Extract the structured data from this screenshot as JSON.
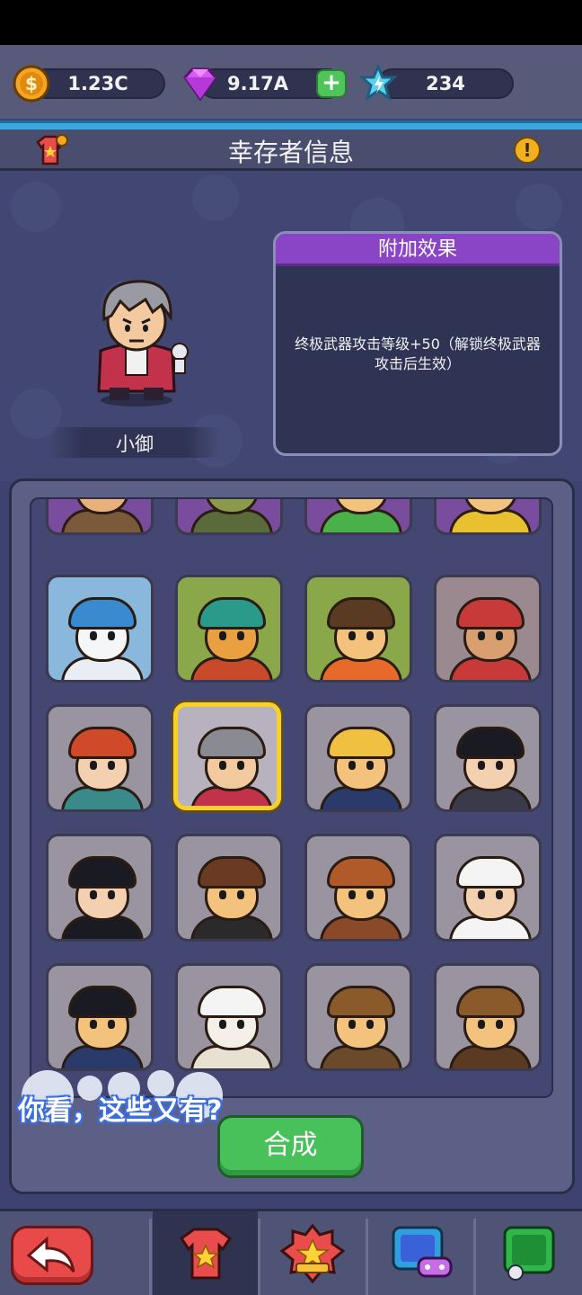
{
  "currency": {
    "gold": "1.23C",
    "gems": "9.17A",
    "stars": "234",
    "gold_icon": "gold-coin-icon",
    "gem_icon": "purple-diamond-icon",
    "star_icon": "blue-star-icon",
    "plus_label": "+"
  },
  "header": {
    "title": "幸存者信息",
    "info_label": "!"
  },
  "hero": {
    "name": "小御"
  },
  "effect": {
    "title": "附加效果",
    "text": "终极武器攻击等级+50（解锁终极武器攻击后生效）"
  },
  "characters": [
    {
      "id": "sunglasses-hero",
      "row": 0,
      "col": 0
    },
    {
      "id": "gasmask-soldier",
      "row": 0,
      "col": 1
    },
    {
      "id": "ginger-hero",
      "row": 0,
      "col": 2
    },
    {
      "id": "red-cap-hero",
      "row": 0,
      "col": 3
    },
    {
      "id": "snowman",
      "row": 1,
      "col": 0
    },
    {
      "id": "dragon-mask",
      "row": 1,
      "col": 1
    },
    {
      "id": "brown-hair-hero",
      "row": 1,
      "col": 2
    },
    {
      "id": "reindeer",
      "row": 1,
      "col": 3
    },
    {
      "id": "elf-archer",
      "row": 2,
      "col": 0
    },
    {
      "id": "grey-hair-lawyer",
      "row": 2,
      "col": 1,
      "selected": true
    },
    {
      "id": "blonde-lawyer",
      "row": 2,
      "col": 2
    },
    {
      "id": "dark-hair-lawyer",
      "row": 2,
      "col": 3
    },
    {
      "id": "top-hat-gentleman",
      "row": 3,
      "col": 0
    },
    {
      "id": "bow-tie-kid",
      "row": 3,
      "col": 1
    },
    {
      "id": "plaid-detective",
      "row": 3,
      "col": 2
    },
    {
      "id": "monocle-thief",
      "row": 3,
      "col": 3
    },
    {
      "id": "black-hair-prosecutor",
      "row": 4,
      "col": 0
    },
    {
      "id": "rabbit-hat-professor",
      "row": 4,
      "col": 1
    },
    {
      "id": "deerstalker-detective-a",
      "row": 4,
      "col": 2
    },
    {
      "id": "deerstalker-detective-b",
      "row": 4,
      "col": 3
    }
  ],
  "subtitle": "你看，这些又有?",
  "actions": {
    "merge_label": "合成",
    "back_icon": "back-arrow-icon"
  },
  "nav": {
    "tabs": [
      "shirt-star-icon",
      "badge-star-icon",
      "tablet-gamepad-icon",
      "green-card-icon"
    ]
  },
  "colors": {
    "background": "#3d4270",
    "accent_purple": "#8a44c6",
    "accent_green": "#49c15a",
    "accent_red": "#e84a4a",
    "selected_border": "#f7d02a"
  }
}
